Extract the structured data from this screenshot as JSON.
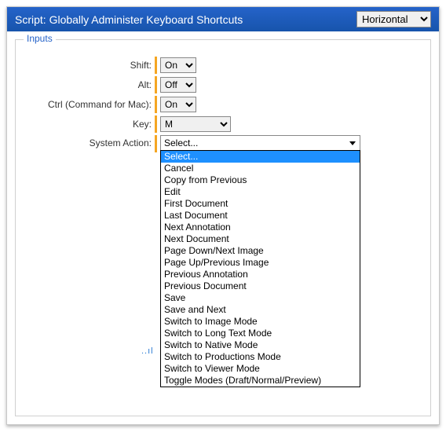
{
  "header": {
    "title": "Script: Globally Administer Keyboard Shortcuts",
    "orientation_value": "Horizontal"
  },
  "section": {
    "label": "Inputs"
  },
  "fields": {
    "shift": {
      "label": "Shift:",
      "value": "On"
    },
    "alt": {
      "label": "Alt:",
      "value": "Off"
    },
    "ctrl": {
      "label": "Ctrl (Command for Mac):",
      "value": "On"
    },
    "key": {
      "label": "Key:",
      "value": "M"
    },
    "action": {
      "label": "System Action:",
      "value": "Select..."
    }
  },
  "action_options": [
    "Select...",
    "Cancel",
    "Copy from Previous",
    "Edit",
    "First Document",
    "Last Document",
    "Next Annotation",
    "Next Document",
    "Page Down/Next Image",
    "Page Up/Previous Image",
    "Previous Annotation",
    "Previous Document",
    "Save",
    "Save and Next",
    "Switch to Image Mode",
    "Switch to Long Text Mode",
    "Switch to Native Mode",
    "Switch to Productions Mode",
    "Switch to Viewer Mode",
    "Toggle Modes (Draft/Normal/Preview)"
  ],
  "decor": {
    "dots": "..ıl"
  }
}
